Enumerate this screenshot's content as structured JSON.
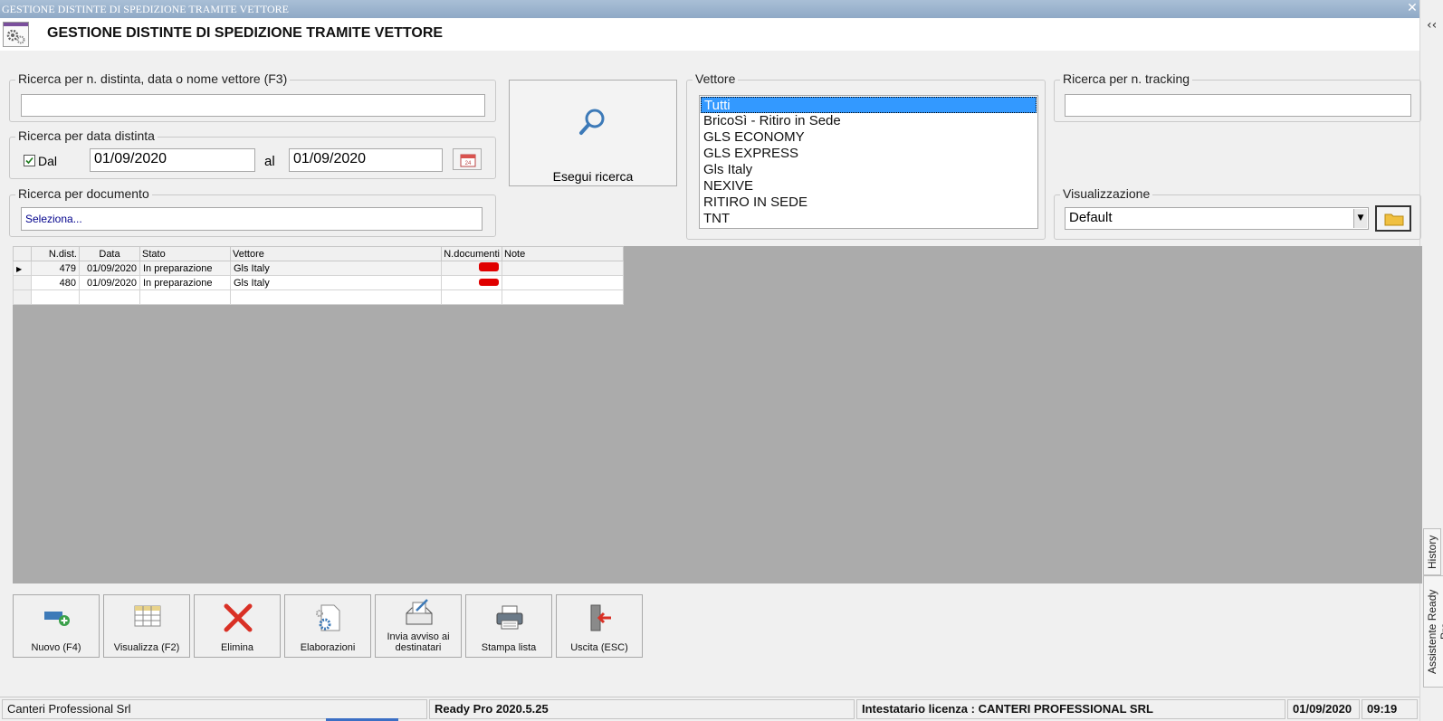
{
  "window": {
    "title": "GESTIONE DISTINTE DI SPEDIZIONE TRAMITE VETTORE",
    "close_glyph": "✕",
    "header_title": "GESTIONE DISTINTE DI SPEDIZIONE TRAMITE VETTORE",
    "collapse_glyph": "‹‹"
  },
  "search_distinta": {
    "label": "Ricerca per n. distinta, data o nome vettore (F3)",
    "value": ""
  },
  "search_data": {
    "label": "Ricerca per data distinta",
    "checkbox_label": "Dal",
    "checked": true,
    "from": "01/09/2020",
    "to_label": "al",
    "to": "01/09/2020",
    "calendar_icon": "calendar-icon"
  },
  "search_documento": {
    "label": "Ricerca per documento",
    "placeholder": "Seleziona..."
  },
  "search_button": {
    "label": "Esegui ricerca",
    "icon": "magnifier-icon"
  },
  "vettore": {
    "label": "Vettore",
    "items": [
      "Tutti",
      "BricoSì - Ritiro in Sede",
      "GLS ECONOMY",
      "GLS EXPRESS",
      "Gls Italy",
      "NEXIVE",
      "RITIRO IN SEDE",
      "TNT"
    ],
    "selected": "Tutti"
  },
  "tracking": {
    "label": "Ricerca per n. tracking",
    "value": ""
  },
  "visualizzazione": {
    "label": "Visualizzazione",
    "value": "Default"
  },
  "grid": {
    "columns": [
      "N.dist.",
      "Data",
      "Stato",
      "Vettore",
      "N.documenti",
      "Note"
    ],
    "rows": [
      {
        "n": "479",
        "data": "01/09/2020",
        "stato": "In preparazione",
        "vettore": "Gls Italy",
        "ndoc": "",
        "note": ""
      },
      {
        "n": "480",
        "data": "01/09/2020",
        "stato": "In preparazione",
        "vettore": "Gls Italy",
        "ndoc": "",
        "note": ""
      }
    ]
  },
  "toolbar": {
    "nuovo": "Nuovo (F4)",
    "visualizza": "Visualizza (F2)",
    "elimina": "Elimina",
    "elaborazioni": "Elaborazioni",
    "invia_line1": "Invia avviso ai",
    "invia_line2": "destinatari",
    "stampa": "Stampa lista",
    "uscita": "Uscita (ESC)"
  },
  "side_tabs": {
    "history": "History",
    "assistente": "Assistente Ready Pro"
  },
  "status": {
    "company": "Canteri Professional Srl",
    "version": "Ready Pro 2020.5.25",
    "license": "Intestatario licenza : CANTERI PROFESSIONAL SRL",
    "date": "01/09/2020",
    "time": "09:19"
  },
  "colors": {
    "selection": "#3399ff",
    "grid_bg": "#ababab",
    "titlebar": "#9fb6cf"
  }
}
